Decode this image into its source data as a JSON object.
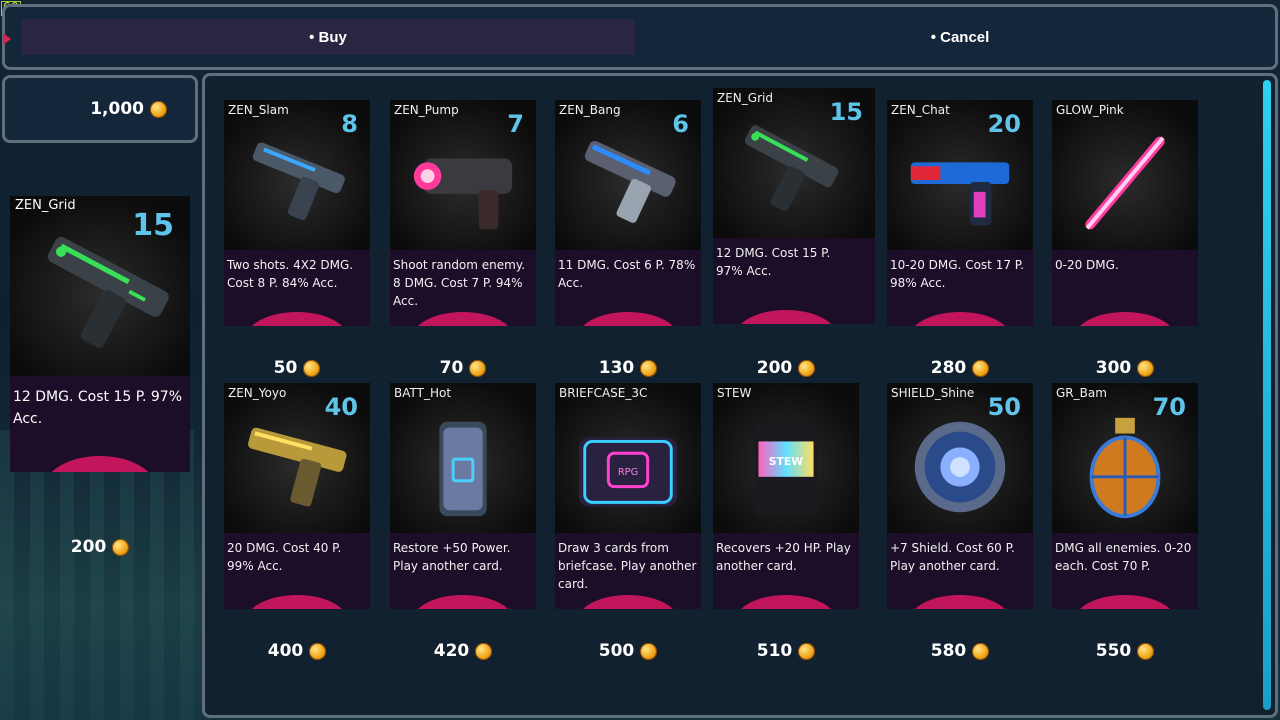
{
  "fps": "60",
  "actions": {
    "buy_label": "• Buy",
    "cancel_label": "• Cancel"
  },
  "wallet": {
    "amount": "1,000"
  },
  "selected": {
    "name": "ZEN_Grid",
    "cost": "15",
    "desc": "12 DMG. Cost 15 P. 97% Acc.",
    "price": "200"
  },
  "colors": {
    "accent_cost": "#5fc4ea",
    "card_arc": "#c2165c",
    "card_bg": "#1c0d28",
    "scrollbar": "#2fd0f0"
  },
  "cards": [
    {
      "name": "ZEN_Slam",
      "cost": "8",
      "desc": "Two shots. 4X2 DMG. Cost 8 P. 84% Acc.",
      "price": "50",
      "icon": "blue-pistol-icon"
    },
    {
      "name": "ZEN_Pump",
      "cost": "7",
      "desc": "Shoot random enemy. 8 DMG. Cost 7 P. 94% Acc.",
      "price": "70",
      "icon": "pink-blaster-icon"
    },
    {
      "name": "ZEN_Bang",
      "cost": "6",
      "desc": "11 DMG. Cost 6 P. 78% Acc.",
      "price": "130",
      "icon": "blue-laser-pistol-icon"
    },
    {
      "name": "ZEN_Grid",
      "cost": "15",
      "desc": "12 DMG. Cost 15 P. 97% Acc.",
      "price": "200",
      "icon": "green-pistol-icon"
    },
    {
      "name": "ZEN_Chat",
      "cost": "20",
      "desc": "10-20 DMG. Cost 17 P. 98% Acc.",
      "price": "280",
      "icon": "red-blue-pistol-icon"
    },
    {
      "name": "GLOW_Pink",
      "cost": "",
      "desc": "0-20 DMG.",
      "price": "300",
      "icon": "pink-glow-blade-icon"
    },
    {
      "name": "ZEN_Yoyo",
      "cost": "40",
      "desc": "20 DMG. Cost 40 P. 99% Acc.",
      "price": "400",
      "icon": "gold-pistol-icon"
    },
    {
      "name": "BATT_Hot",
      "cost": "",
      "desc": "Restore +50 Power. Play another card.",
      "price": "420",
      "icon": "battery-icon"
    },
    {
      "name": "BRIEFCASE_3C",
      "cost": "",
      "desc": "Draw 3 cards from briefcase. Play another card.",
      "price": "500",
      "icon": "briefcase-icon"
    },
    {
      "name": "STEW",
      "cost": "",
      "desc": "Recovers +20 HP. Play another card.",
      "price": "510",
      "icon": "stew-packet-icon"
    },
    {
      "name": "SHIELD_Shine",
      "cost": "50",
      "desc": "+7 Shield. Cost 60 P. Play another card.",
      "price": "580",
      "icon": "shield-icon"
    },
    {
      "name": "GR_Bam",
      "cost": "70",
      "desc": "DMG all enemies. 0-20 each. Cost 70 P.",
      "price": "550",
      "icon": "grenade-icon"
    }
  ]
}
